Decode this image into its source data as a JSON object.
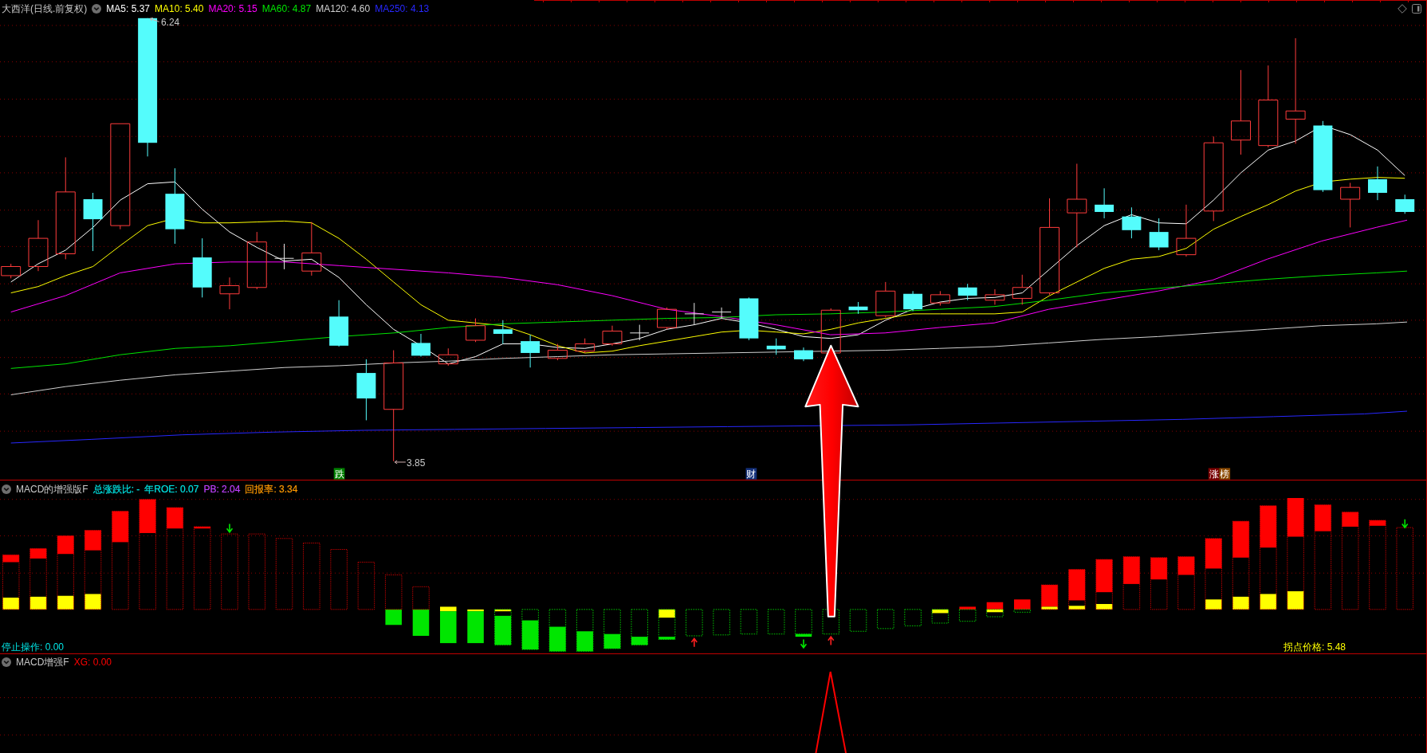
{
  "main_panel": {
    "title": "大西洋(日线.前复权)",
    "indicators": [
      {
        "label": "MA5: 5.37",
        "color": "#ffffff"
      },
      {
        "label": "MA10: 5.40",
        "color": "#ffff00"
      },
      {
        "label": "MA20: 5.15",
        "color": "#ff00ff"
      },
      {
        "label": "MA60: 4.87",
        "color": "#00e600"
      },
      {
        "label": "MA120: 4.60",
        "color": "#d0d0d0"
      },
      {
        "label": "MA250: 4.13",
        "color": "#2828ff"
      }
    ],
    "high_label": "6.24",
    "low_label": "3.85",
    "event_tags": [
      {
        "label": "跌",
        "color": "#008000"
      },
      {
        "label": "财",
        "color": "#14307a"
      },
      {
        "label": "涨",
        "color": "#7a0000"
      },
      {
        "label": "榜",
        "color": "#8b4a00"
      }
    ]
  },
  "macd_panel": {
    "title": "MACD的增强版F",
    "stats": [
      {
        "label": "总涨跌比: -",
        "color": "#00e5e5"
      },
      {
        "label": "年ROE: 0.07",
        "color": "#00e5e5"
      },
      {
        "label": "PB: 2.04",
        "color": "#c040ff"
      },
      {
        "label": "回报率: 3.34",
        "color": "#ff9900"
      }
    ],
    "stop_label": "停止操作: 0.00",
    "turn_price_label": "拐点价格: 5.48"
  },
  "signal_panel": {
    "title": "MACD增强F",
    "readings": [
      {
        "label": "XG: 0.00",
        "color": "#ff0000"
      }
    ]
  }
}
